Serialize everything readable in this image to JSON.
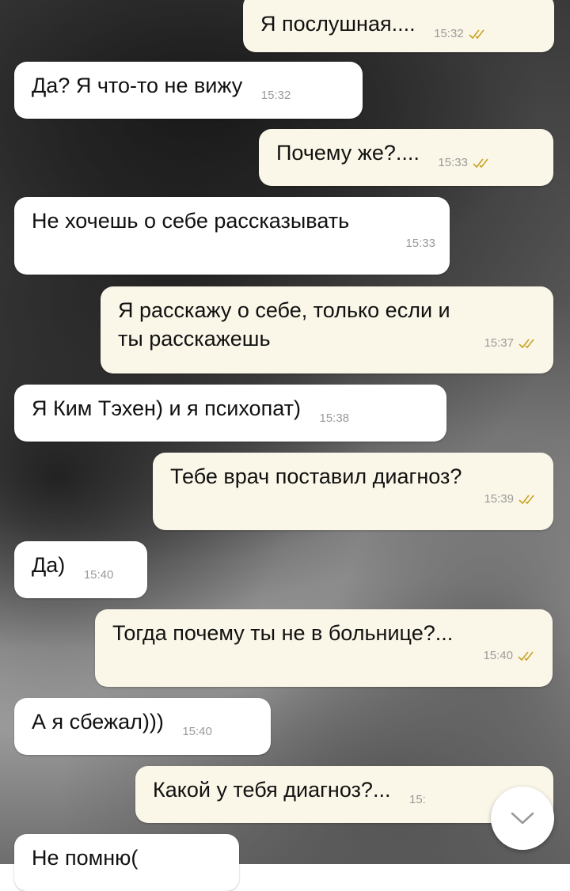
{
  "messages": [
    {
      "dir": "out",
      "text": "Я послушная....",
      "time": "15:32",
      "read": true
    },
    {
      "dir": "in",
      "text": "Да? Я что-то не вижу",
      "time": "15:32"
    },
    {
      "dir": "out",
      "text": "Почему же?....",
      "time": "15:33",
      "read": true
    },
    {
      "dir": "in",
      "text": "Не хочешь о себе рассказывать",
      "time": "15:33"
    },
    {
      "dir": "out",
      "text_line1": "Я расскажу о себе, только если и",
      "text_line2": "ты расскажешь",
      "time": "15:37",
      "read": true
    },
    {
      "dir": "in",
      "text": "Я Ким Тэхен) и я психопат)",
      "time": "15:38"
    },
    {
      "dir": "out",
      "text": "Тебе врач поставил диагноз?",
      "time": "15:39",
      "read": true
    },
    {
      "dir": "in",
      "text": "Да)",
      "time": "15:40"
    },
    {
      "dir": "out",
      "text": "Тогда почему ты не в больнице?...",
      "time": "15:40",
      "read": true
    },
    {
      "dir": "in",
      "text": "А я сбежал)))",
      "time": "15:40"
    },
    {
      "dir": "out",
      "text": "Какой у тебя диагноз?...",
      "time": "15:"
    },
    {
      "dir": "in",
      "text": "Не помню("
    }
  ],
  "colors": {
    "tick": "#c9a227",
    "incoming": "#ffffff",
    "outgoing": "#fbf7e8"
  },
  "icons": {
    "scroll_down": "chevron-down-icon",
    "read_receipt": "double-check-icon"
  }
}
